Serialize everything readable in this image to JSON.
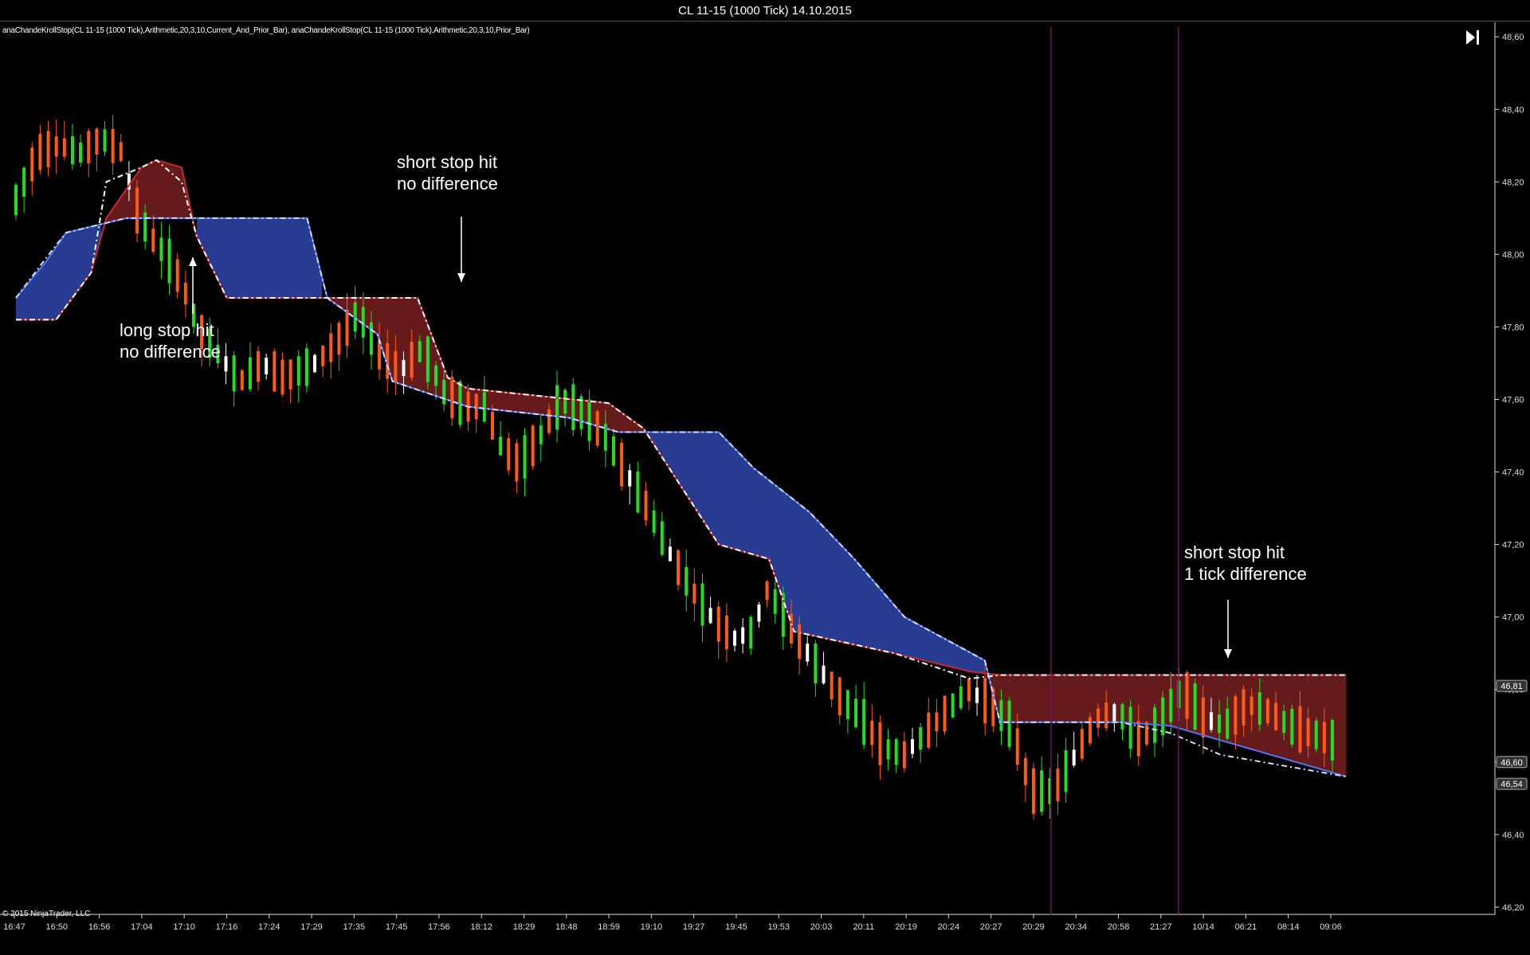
{
  "window": {
    "title": "CL 11-15 (1000 Tick)  14.10.2015"
  },
  "indicator_label": "anaChandeKrollStop(CL 11-15 (1000 Tick),Arithmetic,20,3,10,Current_And_Prior_Bar), anaChandeKrollStop(CL 11-15 (1000 Tick),Arithmetic,20,3,10,Prior_Bar)",
  "copyright": "© 2015 NinjaTrader, LLC",
  "icons": {
    "end": "skip-to-end-icon"
  },
  "annotations": [
    {
      "id": "long-stop",
      "line1": "long stop hit",
      "line2": "no difference"
    },
    {
      "id": "short-stop-1",
      "line1": "short stop hit",
      "line2": "no difference"
    },
    {
      "id": "short-stop-2",
      "line1": "short stop hit",
      "line2": "1 tick difference"
    }
  ],
  "colors": {
    "background": "#000000",
    "up_candle": "#22dd22",
    "down_candle": "#ff5a14",
    "doji": "#ffffff",
    "short_fill": "#6a1c1c",
    "short_line": "#c82828",
    "long_fill": "#2a3f9a",
    "long_line": "#4a78ff",
    "session_break": "#6a1a5a"
  },
  "chart_data": {
    "type": "candlestick",
    "instrument": "CL 11-15 (1000 Tick)",
    "date": "14.10.2015",
    "ylim": [
      46.18,
      48.64
    ],
    "y_ticks": [
      "48,60",
      "48,40",
      "48,20",
      "48,00",
      "47,80",
      "47,60",
      "47,40",
      "47,20",
      "47,00",
      "46,80",
      "46,60",
      "46,40",
      "46,20"
    ],
    "x_ticks": [
      "16:47",
      "16:50",
      "16:56",
      "17:04",
      "17:10",
      "17:16",
      "17:24",
      "17:29",
      "17:35",
      "17:45",
      "17:56",
      "18:12",
      "18:29",
      "18:48",
      "18:59",
      "19:10",
      "19:27",
      "19:45",
      "19:53",
      "20:03",
      "20:11",
      "20:19",
      "20:24",
      "20:27",
      "20:29",
      "20:34",
      "20:58",
      "21:27",
      "10/14",
      "06:21",
      "08:14",
      "09:06"
    ],
    "price_markers": [
      "46,81",
      "46,60",
      "46,54"
    ],
    "session_breaks_after_tick": [
      "20:29",
      "21:27"
    ],
    "n_bars": 164,
    "stop_bands": {
      "short_stop": [
        [
          0,
          47.82
        ],
        [
          8,
          47.82
        ],
        [
          15,
          47.95
        ],
        [
          18,
          48.1
        ],
        [
          25,
          48.24
        ],
        [
          28,
          48.26
        ],
        [
          33,
          48.24
        ],
        [
          36,
          48.05
        ],
        [
          42,
          47.88
        ],
        [
          80,
          47.88
        ],
        [
          86,
          47.66
        ],
        [
          90,
          47.63
        ],
        [
          118,
          47.59
        ],
        [
          125,
          47.52
        ],
        [
          140,
          47.2
        ],
        [
          150,
          47.16
        ],
        [
          155,
          46.96
        ],
        [
          175,
          46.9
        ],
        [
          190,
          46.85
        ],
        [
          196,
          46.84
        ],
        [
          265,
          46.84
        ]
      ],
      "long_stop": [
        [
          0,
          47.88
        ],
        [
          6,
          47.98
        ],
        [
          10,
          48.06
        ],
        [
          22,
          48.1
        ],
        [
          45,
          48.1
        ],
        [
          58,
          48.1
        ],
        [
          62,
          47.88
        ],
        [
          72,
          47.78
        ],
        [
          75,
          47.65
        ],
        [
          90,
          47.58
        ],
        [
          110,
          47.55
        ],
        [
          120,
          47.51
        ],
        [
          140,
          47.51
        ],
        [
          147,
          47.41
        ],
        [
          158,
          47.29
        ],
        [
          167,
          47.16
        ],
        [
          177,
          47.0
        ],
        [
          193,
          46.88
        ],
        [
          196,
          46.71
        ],
        [
          220,
          46.71
        ],
        [
          230,
          46.7
        ],
        [
          240,
          46.66
        ],
        [
          265,
          46.56
        ]
      ],
      "short_stop_prior_bar": [
        [
          0,
          47.82
        ],
        [
          8,
          47.82
        ],
        [
          15,
          47.95
        ],
        [
          18,
          48.2
        ],
        [
          25,
          48.24
        ],
        [
          28,
          48.26
        ],
        [
          33,
          48.2
        ],
        [
          36,
          48.05
        ],
        [
          42,
          47.88
        ],
        [
          80,
          47.88
        ],
        [
          86,
          47.66
        ],
        [
          90,
          47.63
        ],
        [
          118,
          47.59
        ],
        [
          125,
          47.52
        ],
        [
          140,
          47.2
        ],
        [
          150,
          47.16
        ],
        [
          155,
          46.96
        ],
        [
          175,
          46.9
        ],
        [
          190,
          46.83
        ],
        [
          196,
          46.84
        ],
        [
          265,
          46.84
        ]
      ],
      "long_stop_prior_bar": [
        [
          0,
          47.88
        ],
        [
          6,
          47.99
        ],
        [
          10,
          48.06
        ],
        [
          22,
          48.1
        ],
        [
          45,
          48.1
        ],
        [
          58,
          48.1
        ],
        [
          62,
          47.88
        ],
        [
          72,
          47.78
        ],
        [
          75,
          47.65
        ],
        [
          90,
          47.58
        ],
        [
          110,
          47.55
        ],
        [
          120,
          47.51
        ],
        [
          140,
          47.51
        ],
        [
          147,
          47.41
        ],
        [
          158,
          47.29
        ],
        [
          167,
          47.16
        ],
        [
          177,
          47.0
        ],
        [
          193,
          46.88
        ],
        [
          196,
          46.71
        ],
        [
          220,
          46.71
        ],
        [
          230,
          46.68
        ],
        [
          240,
          46.62
        ],
        [
          265,
          46.56
        ]
      ]
    },
    "ohlc_path": [
      [
        0,
        48.15
      ],
      [
        4,
        48.28
      ],
      [
        8,
        48.3
      ],
      [
        12,
        48.28
      ],
      [
        16,
        48.32
      ],
      [
        20,
        48.28
      ],
      [
        22,
        48.14
      ],
      [
        25,
        48.05
      ],
      [
        28,
        48.0
      ],
      [
        31,
        47.92
      ],
      [
        34,
        47.8
      ],
      [
        38,
        47.72
      ],
      [
        42,
        47.65
      ],
      [
        46,
        47.7
      ],
      [
        50,
        47.66
      ],
      [
        56,
        47.7
      ],
      [
        60,
        47.76
      ],
      [
        64,
        47.84
      ],
      [
        68,
        47.72
      ],
      [
        72,
        47.68
      ],
      [
        76,
        47.74
      ],
      [
        80,
        47.62
      ],
      [
        84,
        47.58
      ],
      [
        88,
        47.58
      ],
      [
        90,
        47.48
      ],
      [
        94,
        47.42
      ],
      [
        98,
        47.5
      ],
      [
        102,
        47.6
      ],
      [
        106,
        47.56
      ],
      [
        110,
        47.5
      ],
      [
        114,
        47.4
      ],
      [
        118,
        47.3
      ],
      [
        122,
        47.18
      ],
      [
        126,
        47.08
      ],
      [
        130,
        47.0
      ],
      [
        134,
        46.94
      ],
      [
        138,
        46.96
      ],
      [
        140,
        47.08
      ],
      [
        142,
        47.04
      ],
      [
        146,
        46.94
      ],
      [
        150,
        46.86
      ],
      [
        154,
        46.78
      ],
      [
        158,
        46.72
      ],
      [
        162,
        46.64
      ],
      [
        166,
        46.62
      ],
      [
        170,
        46.68
      ],
      [
        174,
        46.74
      ],
      [
        178,
        46.8
      ],
      [
        182,
        46.76
      ],
      [
        186,
        46.7
      ],
      [
        188,
        46.6
      ],
      [
        190,
        46.52
      ],
      [
        194,
        46.52
      ],
      [
        198,
        46.62
      ],
      [
        202,
        46.72
      ],
      [
        206,
        46.74
      ],
      [
        210,
        46.66
      ],
      [
        214,
        46.72
      ],
      [
        218,
        46.8
      ],
      [
        222,
        46.72
      ],
      [
        226,
        46.7
      ],
      [
        230,
        46.76
      ],
      [
        234,
        46.74
      ],
      [
        238,
        46.7
      ],
      [
        242,
        46.68
      ],
      [
        246,
        46.66
      ]
    ],
    "series": [
      {
        "name": "anaChandeKrollStop(CL 11-15 (1000 Tick),Arithmetic,20,3,10,Current_And_Prior_Bar)"
      },
      {
        "name": "anaChandeKrollStop(CL 11-15 (1000 Tick),Arithmetic,20,3,10,Prior_Bar)"
      }
    ]
  }
}
